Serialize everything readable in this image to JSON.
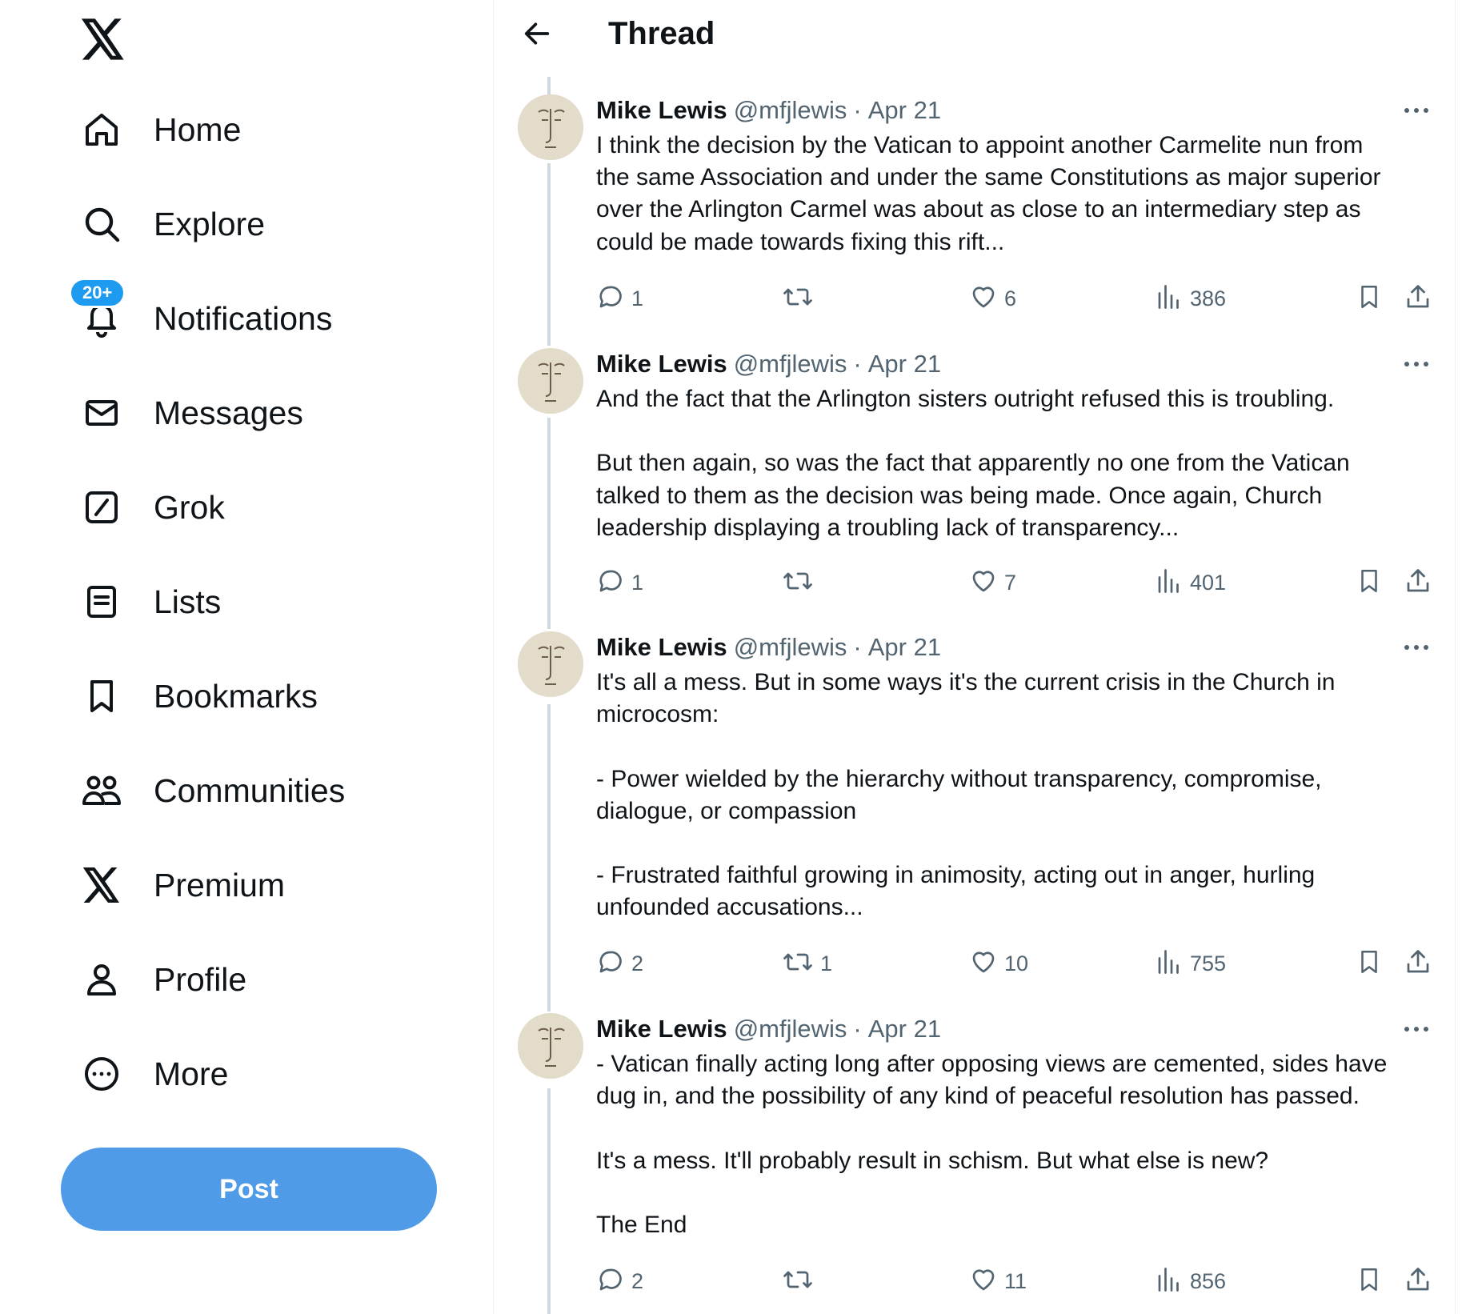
{
  "nav": {
    "items": [
      {
        "label": "Home",
        "icon": "home-icon"
      },
      {
        "label": "Explore",
        "icon": "search-icon"
      },
      {
        "label": "Notifications",
        "icon": "bell-icon",
        "badge": "20+"
      },
      {
        "label": "Messages",
        "icon": "envelope-icon"
      },
      {
        "label": "Grok",
        "icon": "grok-icon"
      },
      {
        "label": "Lists",
        "icon": "list-icon"
      },
      {
        "label": "Bookmarks",
        "icon": "bookmark-icon"
      },
      {
        "label": "Communities",
        "icon": "communities-icon"
      },
      {
        "label": "Premium",
        "icon": "x-logo-icon"
      },
      {
        "label": "Profile",
        "icon": "person-icon"
      },
      {
        "label": "More",
        "icon": "more-circle-icon"
      }
    ],
    "post_label": "Post"
  },
  "header": {
    "title": "Thread"
  },
  "colors": {
    "accent": "#1d9bf0",
    "post_button": "#4f9be7",
    "muted_text": "#536471",
    "thread_line": "#cfd9de"
  },
  "tweets": [
    {
      "name": "Mike Lewis",
      "handle": "@mfjlewis",
      "sep": "·",
      "date": "Apr 21",
      "text": "I think the decision by the Vatican to appoint another Carmelite nun from\nthe same Association and under the same Constitutions as major superior\nover the Arlington Carmel was about as close to an intermediary step as\ncould be made towards fixing this rift...",
      "replies": "1",
      "reposts": "",
      "likes": "6",
      "views": "386"
    },
    {
      "name": "Mike Lewis",
      "handle": "@mfjlewis",
      "sep": "·",
      "date": "Apr 21",
      "text": "And the fact that the Arlington sisters outright refused this is troubling.\n\nBut then again, so was the fact that apparently no one from the Vatican\ntalked to them as the decision was being made. Once again, Church\nleadership displaying a troubling lack of transparency...",
      "replies": "1",
      "reposts": "",
      "likes": "7",
      "views": "401"
    },
    {
      "name": "Mike Lewis",
      "handle": "@mfjlewis",
      "sep": "·",
      "date": "Apr 21",
      "text": "It's all a mess. But in some ways it's the current crisis in the Church in\nmicrocosm:\n\n- Power wielded by the hierarchy without transparency, compromise,\ndialogue, or compassion\n\n- Frustrated faithful growing in animosity, acting out in anger, hurling\nunfounded accusations...",
      "replies": "2",
      "reposts": "1",
      "likes": "10",
      "views": "755"
    },
    {
      "name": "Mike Lewis",
      "handle": "@mfjlewis",
      "sep": "·",
      "date": "Apr 21",
      "text": "- Vatican finally acting long after opposing views are cemented, sides have\ndug in, and the possibility of any kind of peaceful resolution has passed.\n\nIt's a mess. It'll probably result in schism. But what else is new?\n\nThe End",
      "replies": "2",
      "reposts": "",
      "likes": "11",
      "views": "856"
    }
  ]
}
